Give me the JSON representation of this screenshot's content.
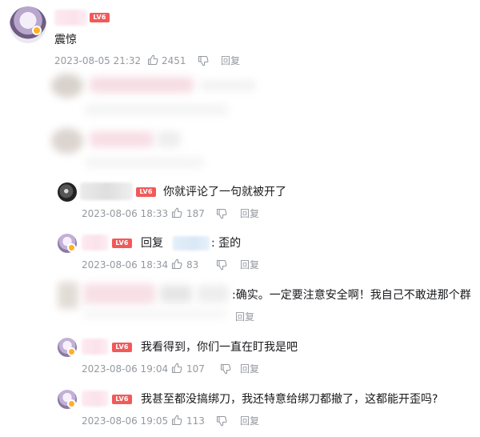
{
  "comments": [
    {
      "text": "震惊",
      "time": "2023-08-05 21:32",
      "likes": "2451",
      "reply_label": "回复",
      "level": "LV6"
    },
    {
      "text": "你就评论了一句就被开了",
      "time": "2023-08-06 18:33",
      "likes": "187",
      "reply_label": "回复",
      "level": "LV6"
    },
    {
      "prefix": "回复",
      "colon_text": ": 歪的",
      "time": "2023-08-06 18:34",
      "likes": "83",
      "reply_label": "回复",
      "level": "LV6"
    },
    {
      "text": ":确实。一定要注意安全啊！我自己不敢进那个群",
      "reply_label": "回复"
    },
    {
      "text": "我看得到，你们一直在盯我是吧",
      "time": "2023-08-06 19:04",
      "likes": "107",
      "reply_label": "回复",
      "level": "LV6"
    },
    {
      "text": "我甚至都没搞绑刀，我还特意给绑刀都撤了，这都能开歪吗?",
      "time": "2023-08-06 19:05",
      "likes": "113",
      "reply_label": "回复",
      "level": "LV6"
    }
  ],
  "colors": {
    "level_badge": "#f15a5a",
    "meta_text": "#9499a0",
    "main_text": "#18191c",
    "vip_badge": "#ffb027"
  }
}
